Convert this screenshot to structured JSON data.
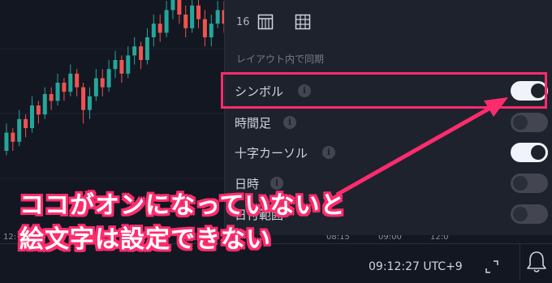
{
  "colors": {
    "accent": "#ff2c6d",
    "candle_up": "#26a69a",
    "candle_down": "#ef5350",
    "panel_bg": "#1e222d"
  },
  "chart": {
    "time_labels": [
      "12:",
      "08:15",
      "09:00",
      "12:0"
    ],
    "candles": [
      {
        "o": 0.3,
        "c": 0.38,
        "h": 0.42,
        "l": 0.28
      },
      {
        "o": 0.38,
        "c": 0.34,
        "h": 0.4,
        "l": 0.3
      },
      {
        "o": 0.34,
        "c": 0.44,
        "h": 0.48,
        "l": 0.32
      },
      {
        "o": 0.44,
        "c": 0.4,
        "h": 0.46,
        "l": 0.36
      },
      {
        "o": 0.4,
        "c": 0.5,
        "h": 0.54,
        "l": 0.38
      },
      {
        "o": 0.5,
        "c": 0.46,
        "h": 0.52,
        "l": 0.42
      },
      {
        "o": 0.46,
        "c": 0.55,
        "h": 0.58,
        "l": 0.44
      },
      {
        "o": 0.55,
        "c": 0.52,
        "h": 0.58,
        "l": 0.48
      },
      {
        "o": 0.52,
        "c": 0.6,
        "h": 0.64,
        "l": 0.5
      },
      {
        "o": 0.6,
        "c": 0.56,
        "h": 0.62,
        "l": 0.52
      },
      {
        "o": 0.56,
        "c": 0.64,
        "h": 0.68,
        "l": 0.54
      },
      {
        "o": 0.64,
        "c": 0.58,
        "h": 0.66,
        "l": 0.54
      },
      {
        "o": 0.58,
        "c": 0.48,
        "h": 0.6,
        "l": 0.42
      },
      {
        "o": 0.48,
        "c": 0.54,
        "h": 0.58,
        "l": 0.44
      },
      {
        "o": 0.54,
        "c": 0.62,
        "h": 0.66,
        "l": 0.52
      },
      {
        "o": 0.62,
        "c": 0.58,
        "h": 0.66,
        "l": 0.54
      },
      {
        "o": 0.58,
        "c": 0.66,
        "h": 0.7,
        "l": 0.56
      },
      {
        "o": 0.66,
        "c": 0.7,
        "h": 0.74,
        "l": 0.62
      },
      {
        "o": 0.7,
        "c": 0.64,
        "h": 0.72,
        "l": 0.6
      },
      {
        "o": 0.64,
        "c": 0.72,
        "h": 0.76,
        "l": 0.62
      },
      {
        "o": 0.72,
        "c": 0.76,
        "h": 0.8,
        "l": 0.68
      },
      {
        "o": 0.76,
        "c": 0.7,
        "h": 0.78,
        "l": 0.66
      },
      {
        "o": 0.7,
        "c": 0.8,
        "h": 0.84,
        "l": 0.68
      },
      {
        "o": 0.8,
        "c": 0.86,
        "h": 0.9,
        "l": 0.76
      },
      {
        "o": 0.86,
        "c": 0.82,
        "h": 0.9,
        "l": 0.78
      },
      {
        "o": 0.82,
        "c": 0.92,
        "h": 0.96,
        "l": 0.8
      },
      {
        "o": 0.92,
        "c": 0.98,
        "h": 1.0,
        "l": 0.88
      },
      {
        "o": 0.98,
        "c": 0.9,
        "h": 1.0,
        "l": 0.86
      },
      {
        "o": 0.9,
        "c": 0.84,
        "h": 0.94,
        "l": 0.8
      },
      {
        "o": 0.84,
        "c": 0.94,
        "h": 0.98,
        "l": 0.82
      },
      {
        "o": 0.94,
        "c": 0.88,
        "h": 0.98,
        "l": 0.84
      },
      {
        "o": 0.88,
        "c": 0.8,
        "h": 0.92,
        "l": 0.76
      },
      {
        "o": 0.8,
        "c": 0.86,
        "h": 0.9,
        "l": 0.76
      },
      {
        "o": 0.86,
        "c": 0.92,
        "h": 0.96,
        "l": 0.84
      },
      {
        "o": 0.92,
        "c": 0.86,
        "h": 0.96,
        "l": 0.82
      }
    ]
  },
  "panel": {
    "size_value": "16",
    "grid_icon_1": "table-grid-icon",
    "grid_icon_2": "grid-icon",
    "section_title": "レイアウト内で同期",
    "rows": [
      {
        "label": "シンボル",
        "has_info": true,
        "on": true
      },
      {
        "label": "時間足",
        "has_info": true,
        "on": false
      },
      {
        "label": "十字カーソル",
        "has_info": true,
        "on": true
      },
      {
        "label": "日時",
        "has_info": true,
        "on": false
      },
      {
        "label": "日付範囲",
        "has_info": false,
        "on": false
      }
    ]
  },
  "status": {
    "clock": "09:12:27 UTC+9"
  },
  "annotation": {
    "line1": "ココがオンになっていないと",
    "line2": "絵文字は設定できない"
  }
}
